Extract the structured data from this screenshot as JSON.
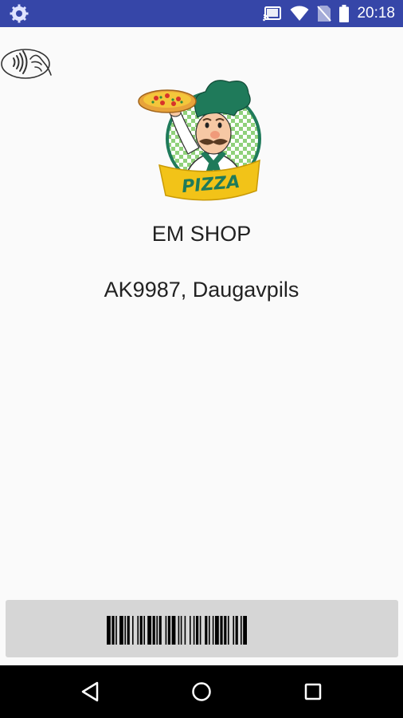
{
  "status_bar": {
    "time": "20:18",
    "icons": [
      "settings-gear-icon",
      "cast-icon",
      "wifi-icon",
      "no-sim-icon",
      "battery-icon"
    ]
  },
  "header": {
    "nfc_icon": "contactless-payment-icon"
  },
  "brand": {
    "logo_text": "PIZZA",
    "colors": {
      "accent": "#3646a8",
      "logo_green": "#1f7a5a",
      "logo_yellow": "#f2c318"
    }
  },
  "shop": {
    "name": "EM SHOP",
    "address": "AK9987, Daugavpils"
  },
  "barcode": {
    "label": "barcode"
  },
  "nav_bar": {
    "buttons": [
      "back-icon",
      "home-icon",
      "recents-icon"
    ]
  }
}
